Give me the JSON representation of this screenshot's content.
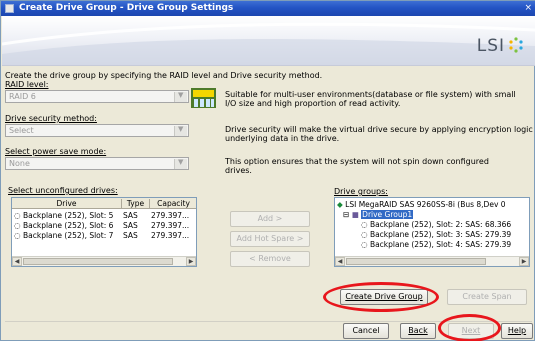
{
  "window": {
    "title": "Create Drive Group - Drive Group Settings",
    "close_glyph": "×"
  },
  "banner": {
    "logo_text": "LSI",
    "logo_mark": "lsi-star-logo"
  },
  "intro": "Create the drive group by specifying the RAID level and Drive security method.",
  "raid": {
    "label": "RAID level:",
    "value": "RAID 6",
    "description_line1": "Suitable for multi-user environments(database or file system) with small",
    "description_line2": "I/O size and high proportion of read activity."
  },
  "security": {
    "label": "Drive security method:",
    "value": "Select",
    "description_line1": "Drive security will make the virtual drive secure by applying encryption logic to",
    "description_line2": "underlying data in the drive."
  },
  "power": {
    "label": "Select power save mode:",
    "value": "None",
    "description_line1": "This option ensures that the system will not spin down configured",
    "description_line2": "drives."
  },
  "unconfigured": {
    "label": "Select unconfigured drives:",
    "columns": [
      "Drive",
      "Type",
      "Capacity"
    ],
    "rows": [
      {
        "drive": "Backplane (252), Slot: 5",
        "type": "SAS",
        "capacity": "279.397..."
      },
      {
        "drive": "Backplane (252), Slot: 6",
        "type": "SAS",
        "capacity": "279.397..."
      },
      {
        "drive": "Backplane (252), Slot: 7",
        "type": "SAS",
        "capacity": "279.397..."
      }
    ]
  },
  "middle_buttons": {
    "add": "Add >",
    "add_hot_spare": "Add Hot Spare >",
    "remove": "< Remove"
  },
  "drive_groups": {
    "label": "Drive groups:",
    "controller": "LSI MegaRAID SAS 9260SS-8i (Bus 8,Dev 0",
    "group": "Drive Group1",
    "drives": [
      "Backplane (252), Slot: 2: SAS: 68.366",
      "Backplane (252), Slot: 3: SAS: 279.39",
      "Backplane (252), Slot: 4: SAS: 279.39"
    ]
  },
  "group_buttons": {
    "create_drive_group": "Create Drive Group",
    "create_span": "Create Span"
  },
  "footer": {
    "cancel": "Cancel",
    "back": "Back",
    "next": "Next",
    "help": "Help"
  },
  "highlight_color": "#e8161c",
  "accent_color": "#316ac5"
}
